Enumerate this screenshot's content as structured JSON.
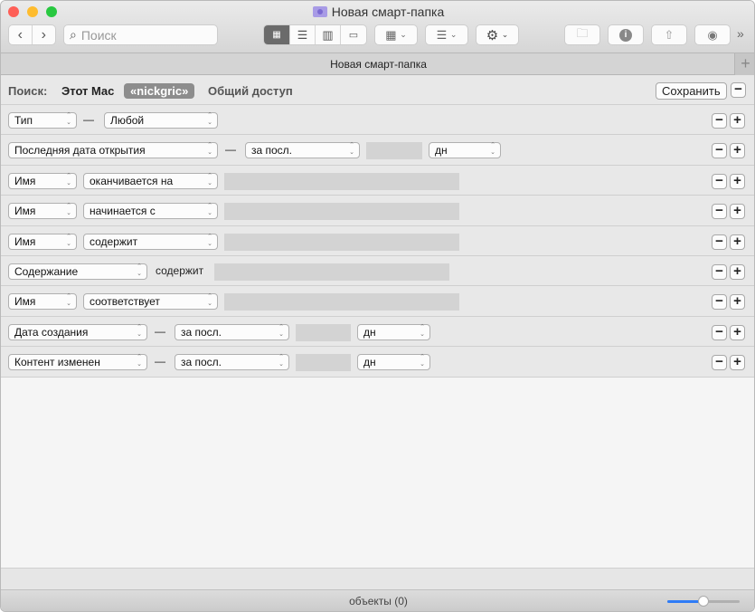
{
  "window": {
    "title": "Новая смарт-папка"
  },
  "toolbar": {
    "search_placeholder": "Поиск",
    "more": "»"
  },
  "tab": {
    "label": "Новая смарт-папка",
    "add": "+"
  },
  "scope": {
    "label": "Поиск:",
    "options": [
      "Этот Mac",
      "«nickgric»",
      "Общий доступ"
    ],
    "selected": 1,
    "save": "Сохранить",
    "remove": "−"
  },
  "rules": [
    {
      "items": [
        {
          "t": "pop",
          "v": "Тип"
        },
        {
          "t": "dash",
          "v": "—"
        },
        {
          "t": "pop",
          "v": "Любой"
        }
      ]
    },
    {
      "items": [
        {
          "t": "pop",
          "v": "Последняя дата открытия"
        },
        {
          "t": "dash",
          "v": "—"
        },
        {
          "t": "pop",
          "v": "за посл."
        },
        {
          "t": "fld",
          "v": ""
        },
        {
          "t": "pop",
          "v": "дн"
        }
      ]
    },
    {
      "items": [
        {
          "t": "pop",
          "v": "Имя"
        },
        {
          "t": "pop",
          "v": "оканчивается на"
        },
        {
          "t": "fld",
          "v": ""
        }
      ]
    },
    {
      "items": [
        {
          "t": "pop",
          "v": "Имя"
        },
        {
          "t": "pop",
          "v": "начинается с"
        },
        {
          "t": "fld",
          "v": ""
        }
      ]
    },
    {
      "items": [
        {
          "t": "pop",
          "v": "Имя"
        },
        {
          "t": "pop",
          "v": "содержит"
        },
        {
          "t": "fld",
          "v": ""
        }
      ]
    },
    {
      "items": [
        {
          "t": "pop",
          "v": "Содержание"
        },
        {
          "t": "lbl",
          "v": "содержит"
        },
        {
          "t": "fld",
          "v": ""
        }
      ]
    },
    {
      "items": [
        {
          "t": "pop",
          "v": "Имя"
        },
        {
          "t": "pop",
          "v": "соответствует"
        },
        {
          "t": "fld",
          "v": ""
        }
      ]
    },
    {
      "items": [
        {
          "t": "pop",
          "v": "Дата создания"
        },
        {
          "t": "dash",
          "v": "—"
        },
        {
          "t": "pop",
          "v": "за посл."
        },
        {
          "t": "fld",
          "v": ""
        },
        {
          "t": "pop",
          "v": "дн"
        }
      ]
    },
    {
      "items": [
        {
          "t": "pop",
          "v": "Контент изменен"
        },
        {
          "t": "dash",
          "v": "—"
        },
        {
          "t": "pop",
          "v": "за посл."
        },
        {
          "t": "fld",
          "v": ""
        },
        {
          "t": "pop",
          "v": "дн"
        }
      ]
    }
  ],
  "rule_buttons": {
    "remove": "−",
    "add": "+"
  },
  "status": {
    "text": "объекты (0)",
    "icon_size_percent": 50
  },
  "colors": {
    "close": "#fe5f57",
    "minimize": "#febc2e",
    "zoom": "#28c840",
    "accent": "#2f7cf6"
  }
}
